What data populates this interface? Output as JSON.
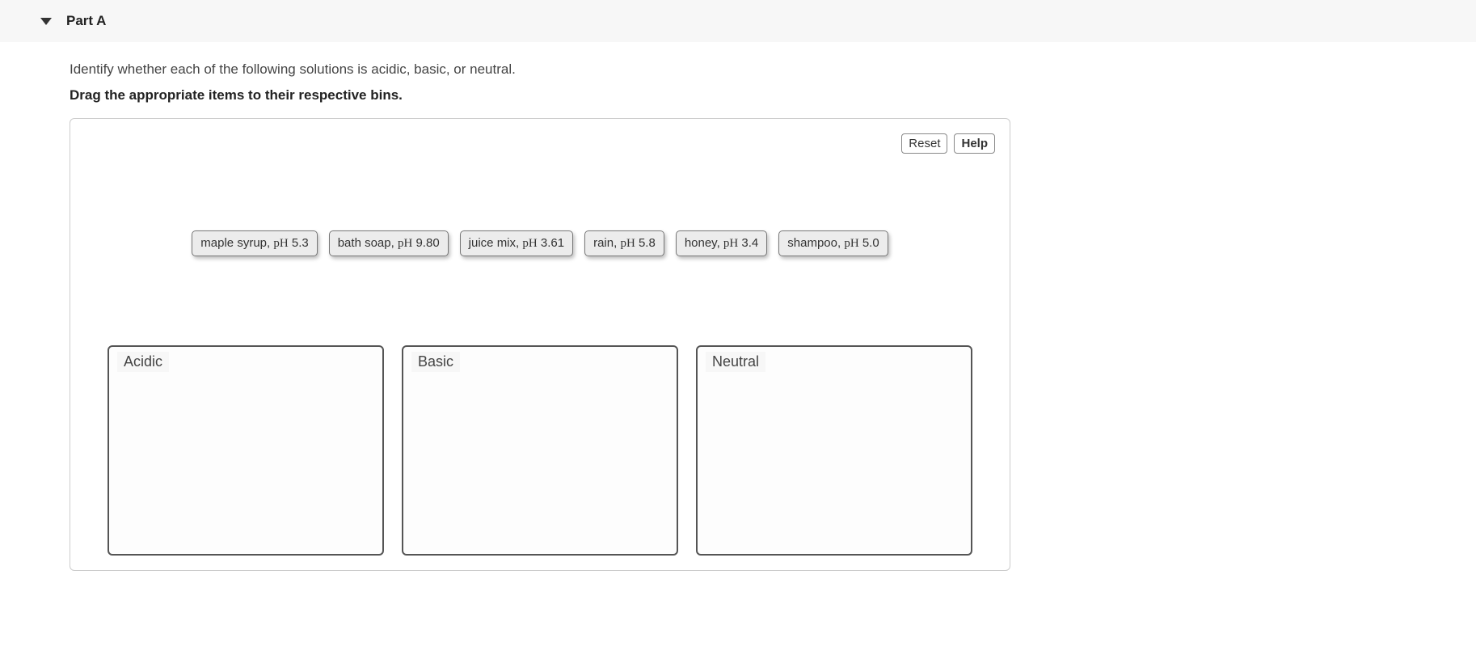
{
  "header": {
    "title": "Part A"
  },
  "prompt": "Identify whether each of the following solutions is acidic, basic, or neutral.",
  "instruction": "Drag the appropriate items to their respective bins.",
  "toolbar": {
    "reset": "Reset",
    "help": "Help"
  },
  "items": [
    {
      "name": "maple syrup, ",
      "ph_label": "pH",
      "ph_value": " 5.3"
    },
    {
      "name": "bath soap, ",
      "ph_label": "pH",
      "ph_value": " 9.80"
    },
    {
      "name": "juice mix, ",
      "ph_label": "pH",
      "ph_value": " 3.61"
    },
    {
      "name": "rain, ",
      "ph_label": "pH",
      "ph_value": " 5.8"
    },
    {
      "name": "honey, ",
      "ph_label": "pH",
      "ph_value": " 3.4"
    },
    {
      "name": "shampoo, ",
      "ph_label": "pH",
      "ph_value": " 5.0"
    }
  ],
  "bins": [
    {
      "label": "Acidic"
    },
    {
      "label": "Basic"
    },
    {
      "label": "Neutral"
    }
  ]
}
